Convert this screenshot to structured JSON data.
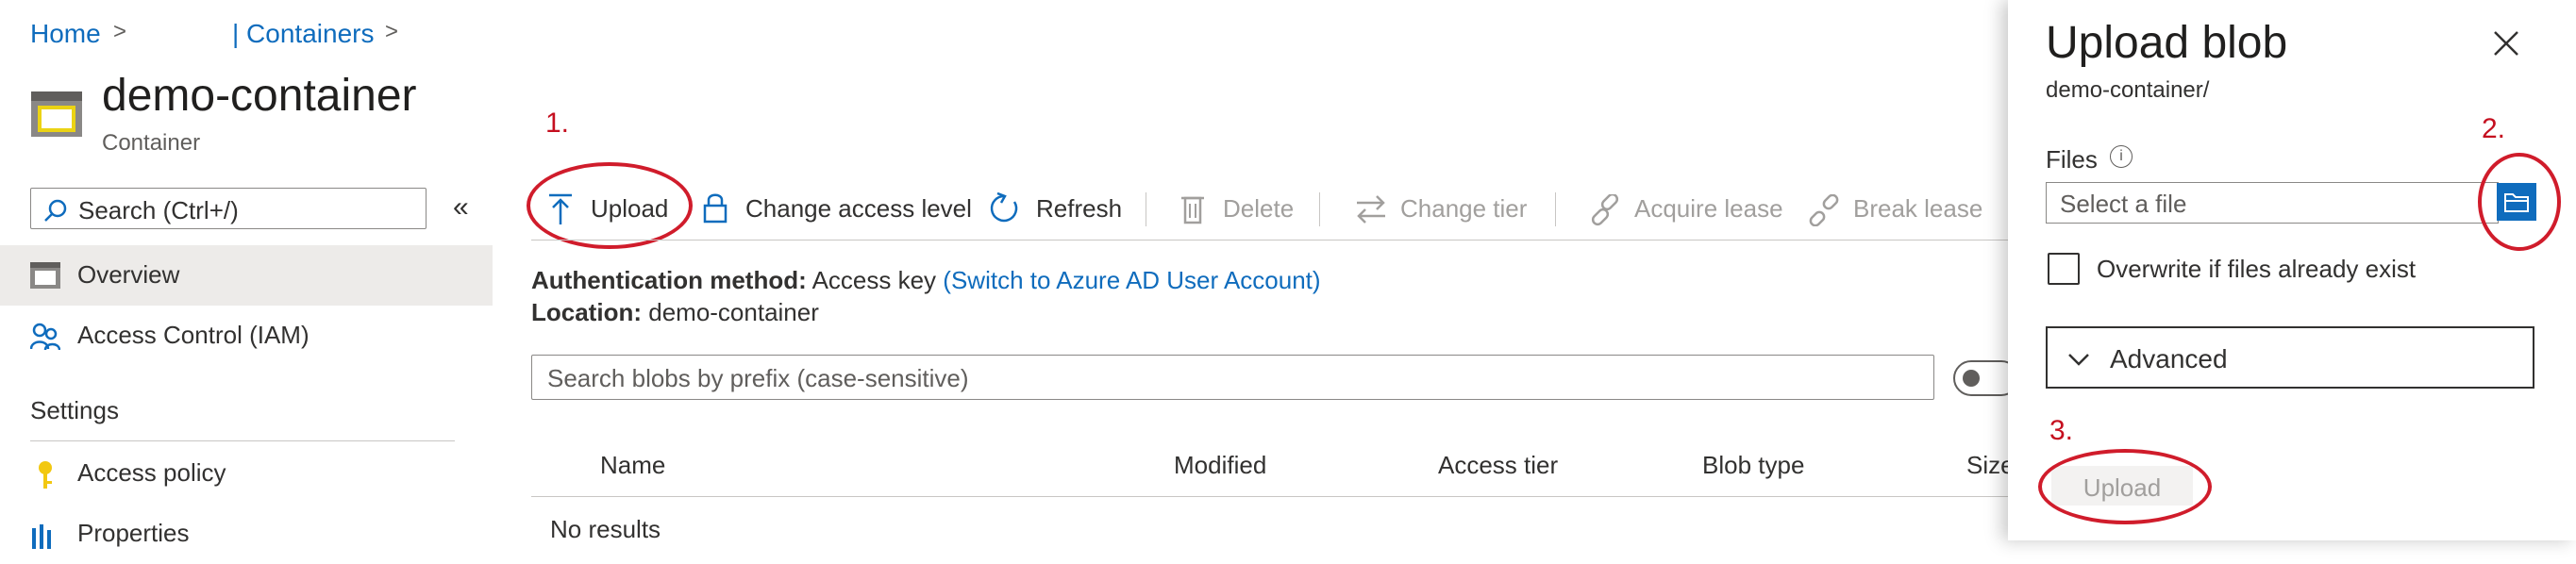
{
  "breadcrumb": {
    "home": "Home",
    "containers": "| Containers",
    "sep": ">"
  },
  "header": {
    "title": "demo-container",
    "subtitle": "Container"
  },
  "sidebar": {
    "search_placeholder": "Search (Ctrl+/)",
    "collapse": "«",
    "items": [
      {
        "label": "Overview"
      },
      {
        "label": "Access Control (IAM)"
      }
    ],
    "settings_title": "Settings",
    "settings_items": [
      {
        "label": "Access policy"
      },
      {
        "label": "Properties"
      }
    ]
  },
  "toolbar": {
    "upload": "Upload",
    "change_access": "Change access level",
    "refresh": "Refresh",
    "delete": "Delete",
    "change_tier": "Change tier",
    "acquire_lease": "Acquire lease",
    "break_lease": "Break lease"
  },
  "info": {
    "auth_label": "Authentication method:",
    "auth_value": "Access key",
    "auth_link": "(Switch to Azure AD User Account)",
    "location_label": "Location:",
    "location_value": "demo-container"
  },
  "blobs": {
    "search_placeholder": "Search blobs by prefix (case-sensitive)",
    "columns": [
      "Name",
      "Modified",
      "Access tier",
      "Blob type",
      "Size"
    ],
    "empty": "No results"
  },
  "annotations": {
    "one": "1.",
    "two": "2.",
    "three": "3."
  },
  "panel": {
    "title": "Upload blob",
    "subtitle": "demo-container/",
    "files_label": "Files",
    "info_glyph": "i",
    "file_placeholder": "Select a file",
    "overwrite_label": "Overwrite if files already exist",
    "advanced_label": "Advanced",
    "upload_button": "Upload"
  },
  "colors": {
    "accent": "#0f6cbd",
    "annotation": "#d01c2b",
    "disabled": "#a19f9d"
  }
}
